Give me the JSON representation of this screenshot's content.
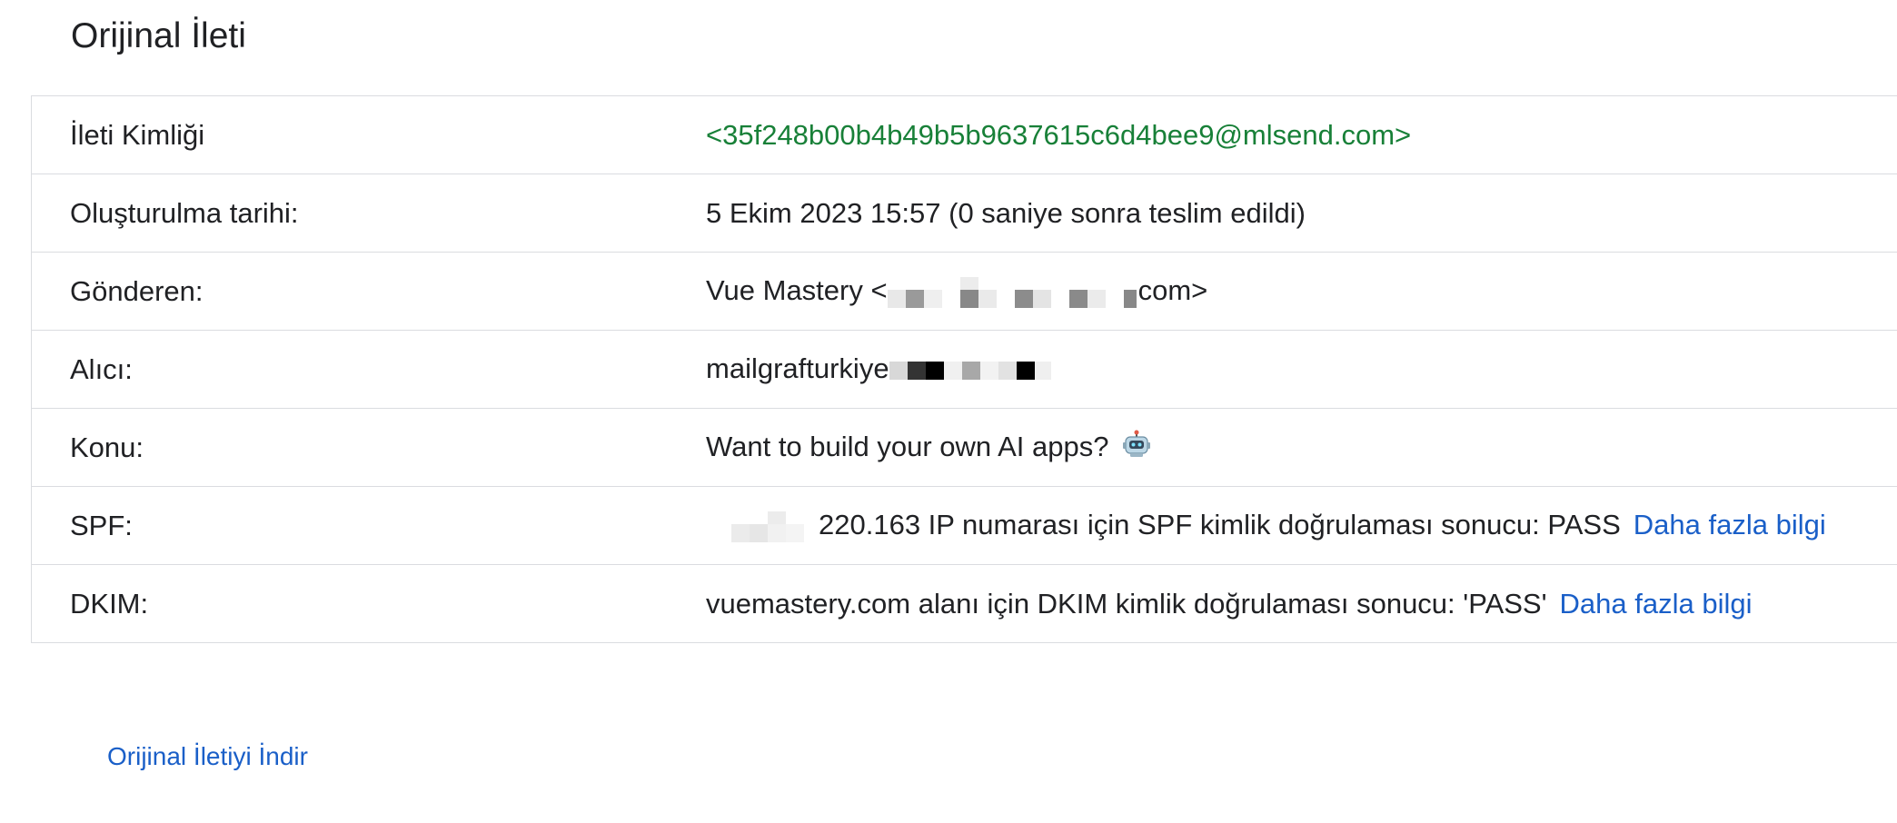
{
  "page": {
    "title": "Orijinal İleti"
  },
  "headers": {
    "message_id": {
      "label": "İleti Kimliği",
      "value": "<35f248b00b4b49b5b9637615c6d4bee9@mlsend.com>"
    },
    "created": {
      "label": "Oluşturulma tarihi:",
      "value": "5 Ekim 2023 15:57 (0 saniye sonra teslim edildi)"
    },
    "from": {
      "label": "Gönderen:",
      "value_prefix": "Vue Mastery <",
      "value_suffix": "com>"
    },
    "to": {
      "label": "Alıcı:",
      "value_prefix": "mailgrafturkiye"
    },
    "subject": {
      "label": "Konu:",
      "value": "Want to build your own AI apps?",
      "icon": "robot-emoji-icon"
    },
    "spf": {
      "label": "SPF:",
      "value": "220.163 IP numarası için SPF kimlik doğrulaması sonucu: PASS",
      "link": "Daha fazla bilgi"
    },
    "dkim": {
      "label": "DKIM:",
      "value": "vuemastery.com alanı için DKIM kimlik doğrulaması sonucu: 'PASS'",
      "link": "Daha fazla bilgi"
    }
  },
  "footer": {
    "download_label": "Orijinal İletiyi İndir"
  },
  "colors": {
    "message_id": "#188038",
    "link": "#1a5fc8",
    "border": "#dadce0"
  }
}
